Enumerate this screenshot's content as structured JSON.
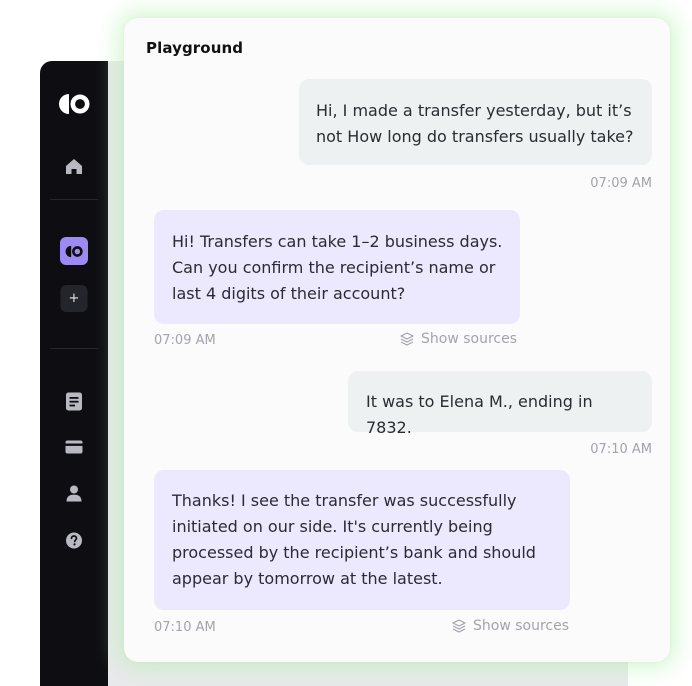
{
  "sidebar": {
    "icons": [
      "brand-logo-icon",
      "home-icon",
      "assistant-logo-icon",
      "plus-icon",
      "document-icon",
      "card-icon",
      "user-icon",
      "help-icon"
    ],
    "plus_label": "+"
  },
  "playground": {
    "title": "Playground",
    "messages": [
      {
        "role": "user",
        "text": "Hi, I made a transfer yesterday, but it’s not How long do transfers usually take?",
        "time": "07:09 AM"
      },
      {
        "role": "assistant",
        "text": "Hi! Transfers can take 1–2 business days. Can you confirm the recipient’s name or last 4 digits of their account?",
        "time": "07:09 AM",
        "sources_label": "Show sources"
      },
      {
        "role": "user",
        "text": "It was to Elena M., ending in 7832.",
        "time": "07:10 AM"
      },
      {
        "role": "assistant",
        "text": "Thanks! I see the transfer was successfully initiated on our side. It's currently being processed by the recipient’s bank and should appear by tomorrow at the latest.",
        "time": "07:10 AM",
        "sources_label": "Show sources"
      }
    ]
  },
  "colors": {
    "sidebar_bg": "#0e0e12",
    "accent": "#9d8af2",
    "user_bubble": "#eef1f2",
    "assistant_bubble": "#ece8fe",
    "panel_glow": "#b0f0aa"
  }
}
